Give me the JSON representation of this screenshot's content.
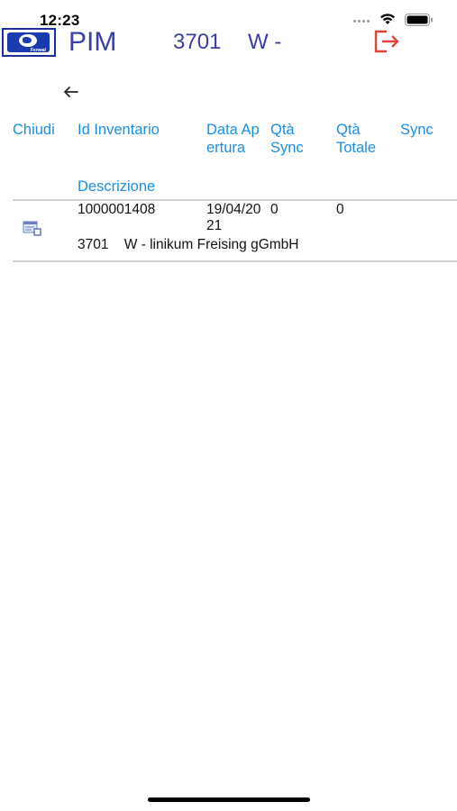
{
  "status_bar": {
    "time": "12:23"
  },
  "header": {
    "logo_text": "Fenwal",
    "app_title": "PIM",
    "site_code": "3701",
    "site_name": "W -"
  },
  "table": {
    "columns": {
      "close": "Chiudi",
      "inventory_id": "Id Inventario",
      "opening_date": "Data Apertura",
      "qty_sync": "Qtà Sync",
      "qty_total": "Qtà Totale",
      "sync": "Sync",
      "description": "Descrizione"
    },
    "rows": [
      {
        "inventory_id": "1000001408",
        "opening_date": "19/04/2021",
        "qty_sync": "0",
        "qty_total": "0",
        "description": "3701    W - linikum Freising gGmbH"
      }
    ]
  },
  "colors": {
    "accent": "#1a8fe0",
    "title": "#3a3fa8",
    "logout": "#e0443a"
  },
  "icons": [
    "wifi-icon",
    "battery-icon",
    "logout-icon",
    "back-arrow-icon",
    "inventory-row-icon"
  ]
}
